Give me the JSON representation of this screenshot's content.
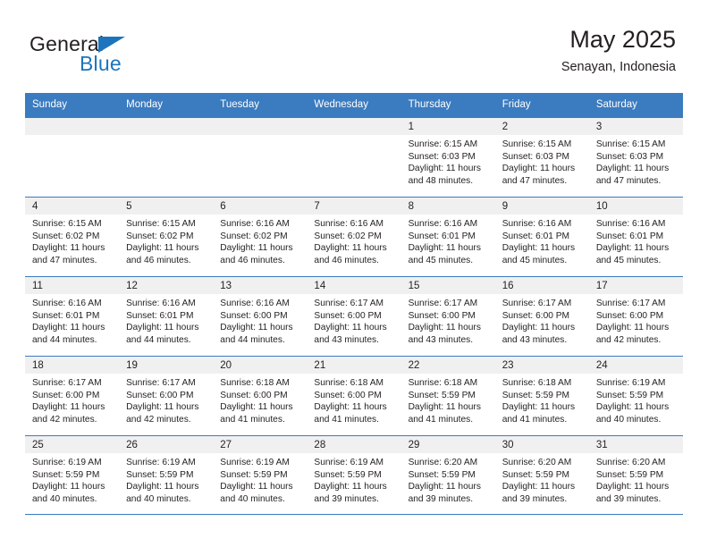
{
  "logo": {
    "word_top": "General",
    "word_bottom": "Blue",
    "accent_color": "#1c75bc"
  },
  "header": {
    "title": "May 2025",
    "subtitle": "Senayan, Indonesia"
  },
  "theme": {
    "header_blue": "#3b7bbf",
    "band_gray": "#f0f0f0",
    "text": "#231f20"
  },
  "weekdays": [
    "Sunday",
    "Monday",
    "Tuesday",
    "Wednesday",
    "Thursday",
    "Friday",
    "Saturday"
  ],
  "weeks": [
    [
      {
        "day": "",
        "sunrise": "",
        "sunset": "",
        "daylight1": "",
        "daylight2": ""
      },
      {
        "day": "",
        "sunrise": "",
        "sunset": "",
        "daylight1": "",
        "daylight2": ""
      },
      {
        "day": "",
        "sunrise": "",
        "sunset": "",
        "daylight1": "",
        "daylight2": ""
      },
      {
        "day": "",
        "sunrise": "",
        "sunset": "",
        "daylight1": "",
        "daylight2": ""
      },
      {
        "day": "1",
        "sunrise": "Sunrise: 6:15 AM",
        "sunset": "Sunset: 6:03 PM",
        "daylight1": "Daylight: 11 hours",
        "daylight2": "and 48 minutes."
      },
      {
        "day": "2",
        "sunrise": "Sunrise: 6:15 AM",
        "sunset": "Sunset: 6:03 PM",
        "daylight1": "Daylight: 11 hours",
        "daylight2": "and 47 minutes."
      },
      {
        "day": "3",
        "sunrise": "Sunrise: 6:15 AM",
        "sunset": "Sunset: 6:03 PM",
        "daylight1": "Daylight: 11 hours",
        "daylight2": "and 47 minutes."
      }
    ],
    [
      {
        "day": "4",
        "sunrise": "Sunrise: 6:15 AM",
        "sunset": "Sunset: 6:02 PM",
        "daylight1": "Daylight: 11 hours",
        "daylight2": "and 47 minutes."
      },
      {
        "day": "5",
        "sunrise": "Sunrise: 6:15 AM",
        "sunset": "Sunset: 6:02 PM",
        "daylight1": "Daylight: 11 hours",
        "daylight2": "and 46 minutes."
      },
      {
        "day": "6",
        "sunrise": "Sunrise: 6:16 AM",
        "sunset": "Sunset: 6:02 PM",
        "daylight1": "Daylight: 11 hours",
        "daylight2": "and 46 minutes."
      },
      {
        "day": "7",
        "sunrise": "Sunrise: 6:16 AM",
        "sunset": "Sunset: 6:02 PM",
        "daylight1": "Daylight: 11 hours",
        "daylight2": "and 46 minutes."
      },
      {
        "day": "8",
        "sunrise": "Sunrise: 6:16 AM",
        "sunset": "Sunset: 6:01 PM",
        "daylight1": "Daylight: 11 hours",
        "daylight2": "and 45 minutes."
      },
      {
        "day": "9",
        "sunrise": "Sunrise: 6:16 AM",
        "sunset": "Sunset: 6:01 PM",
        "daylight1": "Daylight: 11 hours",
        "daylight2": "and 45 minutes."
      },
      {
        "day": "10",
        "sunrise": "Sunrise: 6:16 AM",
        "sunset": "Sunset: 6:01 PM",
        "daylight1": "Daylight: 11 hours",
        "daylight2": "and 45 minutes."
      }
    ],
    [
      {
        "day": "11",
        "sunrise": "Sunrise: 6:16 AM",
        "sunset": "Sunset: 6:01 PM",
        "daylight1": "Daylight: 11 hours",
        "daylight2": "and 44 minutes."
      },
      {
        "day": "12",
        "sunrise": "Sunrise: 6:16 AM",
        "sunset": "Sunset: 6:01 PM",
        "daylight1": "Daylight: 11 hours",
        "daylight2": "and 44 minutes."
      },
      {
        "day": "13",
        "sunrise": "Sunrise: 6:16 AM",
        "sunset": "Sunset: 6:00 PM",
        "daylight1": "Daylight: 11 hours",
        "daylight2": "and 44 minutes."
      },
      {
        "day": "14",
        "sunrise": "Sunrise: 6:17 AM",
        "sunset": "Sunset: 6:00 PM",
        "daylight1": "Daylight: 11 hours",
        "daylight2": "and 43 minutes."
      },
      {
        "day": "15",
        "sunrise": "Sunrise: 6:17 AM",
        "sunset": "Sunset: 6:00 PM",
        "daylight1": "Daylight: 11 hours",
        "daylight2": "and 43 minutes."
      },
      {
        "day": "16",
        "sunrise": "Sunrise: 6:17 AM",
        "sunset": "Sunset: 6:00 PM",
        "daylight1": "Daylight: 11 hours",
        "daylight2": "and 43 minutes."
      },
      {
        "day": "17",
        "sunrise": "Sunrise: 6:17 AM",
        "sunset": "Sunset: 6:00 PM",
        "daylight1": "Daylight: 11 hours",
        "daylight2": "and 42 minutes."
      }
    ],
    [
      {
        "day": "18",
        "sunrise": "Sunrise: 6:17 AM",
        "sunset": "Sunset: 6:00 PM",
        "daylight1": "Daylight: 11 hours",
        "daylight2": "and 42 minutes."
      },
      {
        "day": "19",
        "sunrise": "Sunrise: 6:17 AM",
        "sunset": "Sunset: 6:00 PM",
        "daylight1": "Daylight: 11 hours",
        "daylight2": "and 42 minutes."
      },
      {
        "day": "20",
        "sunrise": "Sunrise: 6:18 AM",
        "sunset": "Sunset: 6:00 PM",
        "daylight1": "Daylight: 11 hours",
        "daylight2": "and 41 minutes."
      },
      {
        "day": "21",
        "sunrise": "Sunrise: 6:18 AM",
        "sunset": "Sunset: 6:00 PM",
        "daylight1": "Daylight: 11 hours",
        "daylight2": "and 41 minutes."
      },
      {
        "day": "22",
        "sunrise": "Sunrise: 6:18 AM",
        "sunset": "Sunset: 5:59 PM",
        "daylight1": "Daylight: 11 hours",
        "daylight2": "and 41 minutes."
      },
      {
        "day": "23",
        "sunrise": "Sunrise: 6:18 AM",
        "sunset": "Sunset: 5:59 PM",
        "daylight1": "Daylight: 11 hours",
        "daylight2": "and 41 minutes."
      },
      {
        "day": "24",
        "sunrise": "Sunrise: 6:19 AM",
        "sunset": "Sunset: 5:59 PM",
        "daylight1": "Daylight: 11 hours",
        "daylight2": "and 40 minutes."
      }
    ],
    [
      {
        "day": "25",
        "sunrise": "Sunrise: 6:19 AM",
        "sunset": "Sunset: 5:59 PM",
        "daylight1": "Daylight: 11 hours",
        "daylight2": "and 40 minutes."
      },
      {
        "day": "26",
        "sunrise": "Sunrise: 6:19 AM",
        "sunset": "Sunset: 5:59 PM",
        "daylight1": "Daylight: 11 hours",
        "daylight2": "and 40 minutes."
      },
      {
        "day": "27",
        "sunrise": "Sunrise: 6:19 AM",
        "sunset": "Sunset: 5:59 PM",
        "daylight1": "Daylight: 11 hours",
        "daylight2": "and 40 minutes."
      },
      {
        "day": "28",
        "sunrise": "Sunrise: 6:19 AM",
        "sunset": "Sunset: 5:59 PM",
        "daylight1": "Daylight: 11 hours",
        "daylight2": "and 39 minutes."
      },
      {
        "day": "29",
        "sunrise": "Sunrise: 6:20 AM",
        "sunset": "Sunset: 5:59 PM",
        "daylight1": "Daylight: 11 hours",
        "daylight2": "and 39 minutes."
      },
      {
        "day": "30",
        "sunrise": "Sunrise: 6:20 AM",
        "sunset": "Sunset: 5:59 PM",
        "daylight1": "Daylight: 11 hours",
        "daylight2": "and 39 minutes."
      },
      {
        "day": "31",
        "sunrise": "Sunrise: 6:20 AM",
        "sunset": "Sunset: 5:59 PM",
        "daylight1": "Daylight: 11 hours",
        "daylight2": "and 39 minutes."
      }
    ]
  ]
}
